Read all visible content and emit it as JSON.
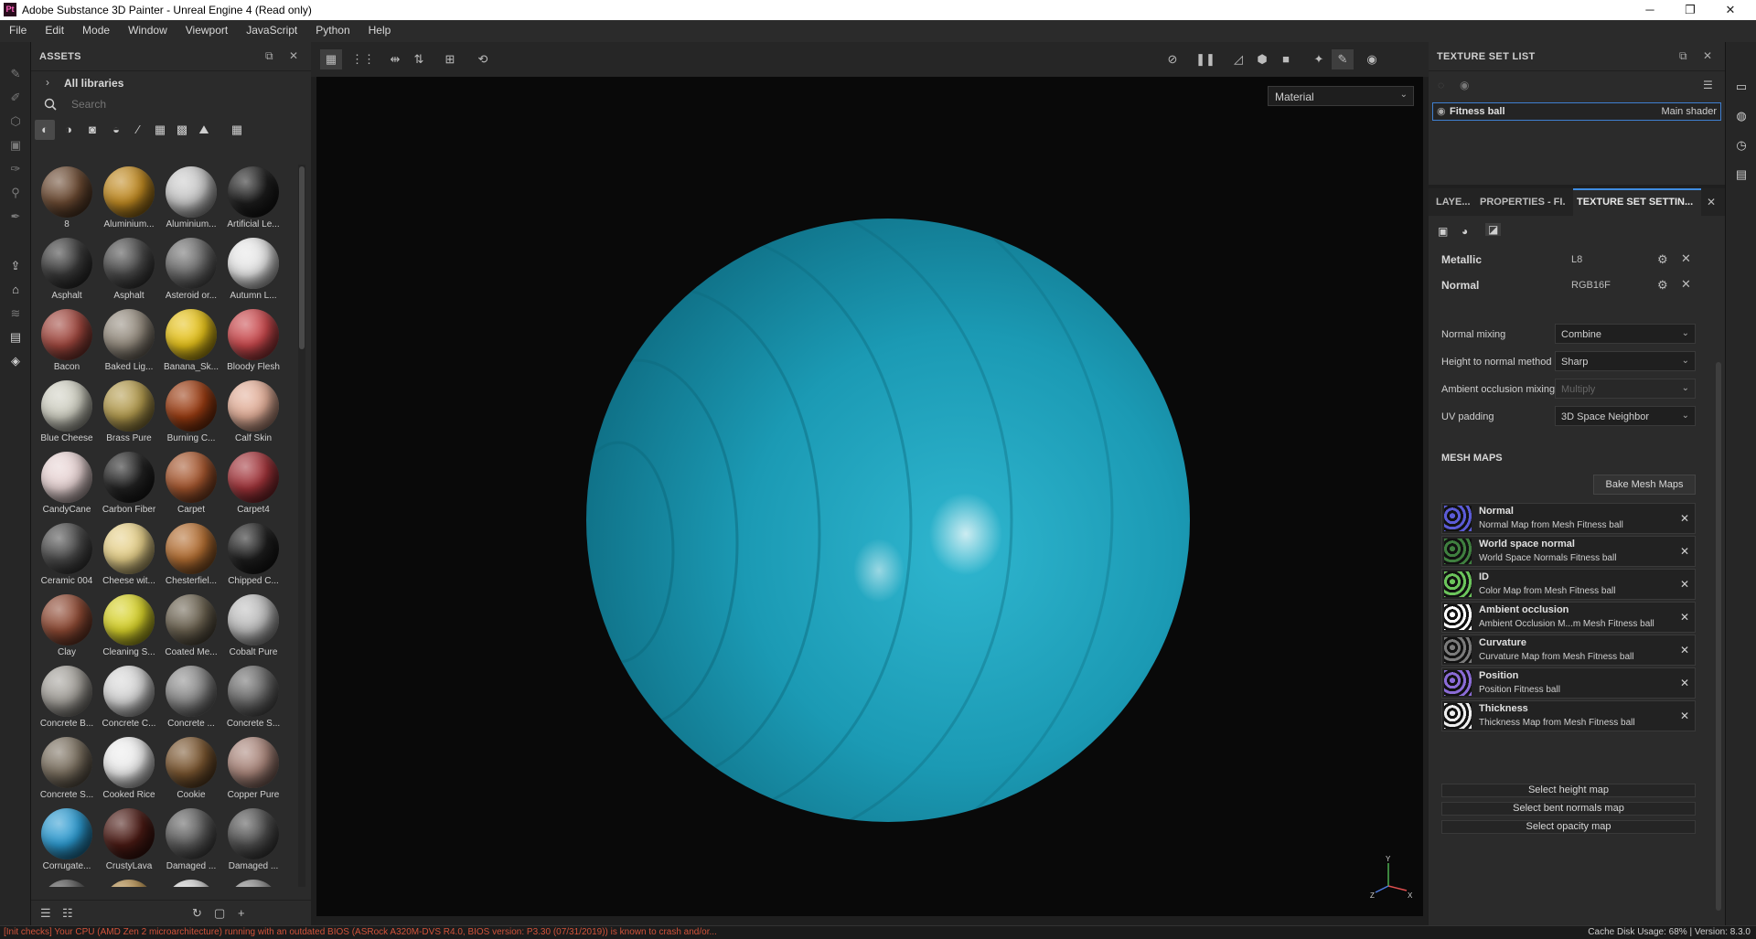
{
  "window": {
    "app_icon": "Pt",
    "title": "Adobe Substance 3D Painter - Unreal Engine 4 (Read only)",
    "minimize": "─",
    "maximize": "❐",
    "close": "✕"
  },
  "menu": [
    "File",
    "Edit",
    "Mode",
    "Window",
    "Viewport",
    "JavaScript",
    "Python",
    "Help"
  ],
  "assets": {
    "title": "ASSETS",
    "all_libraries": "All libraries",
    "search_placeholder": "Search",
    "items": [
      {
        "label": "8",
        "color": "#6b4a32"
      },
      {
        "label": "Aluminium...",
        "color": "#c08a22"
      },
      {
        "label": "Aluminium...",
        "color": "#c9c9c9"
      },
      {
        "label": "Artificial Le...",
        "color": "#1d1d1d"
      },
      {
        "label": "Asphalt",
        "color": "#3a3a3a"
      },
      {
        "label": "Asphalt",
        "color": "#4a4a4a"
      },
      {
        "label": "Asteroid or...",
        "color": "#6c6c6c"
      },
      {
        "label": "Autumn L...",
        "color": "#e6e6e6"
      },
      {
        "label": "Bacon",
        "color": "#a0473e"
      },
      {
        "label": "Baked Lig...",
        "color": "#948b7e"
      },
      {
        "label": "Banana_Sk...",
        "color": "#e6c21a"
      },
      {
        "label": "Bloody Flesh",
        "color": "#c9484c"
      },
      {
        "label": "Blue Cheese",
        "color": "#cfcfc2"
      },
      {
        "label": "Brass Pure",
        "color": "#b39b4e"
      },
      {
        "label": "Burning C...",
        "color": "#9a3c12"
      },
      {
        "label": "Calf Skin",
        "color": "#e2ae98"
      },
      {
        "label": "CandyCane",
        "color": "#e7d3d3"
      },
      {
        "label": "Carbon Fiber",
        "color": "#222222"
      },
      {
        "label": "Carpet",
        "color": "#a5562e"
      },
      {
        "label": "Carpet4",
        "color": "#a1343a"
      },
      {
        "label": "Ceramic 004",
        "color": "#4a4a4a"
      },
      {
        "label": "Cheese wit...",
        "color": "#e6d08a"
      },
      {
        "label": "Chesterfiel...",
        "color": "#b36e32"
      },
      {
        "label": "Chipped C...",
        "color": "#1e1e1e"
      },
      {
        "label": "Clay",
        "color": "#8e4a34"
      },
      {
        "label": "Cleaning S...",
        "color": "#d7d22a"
      },
      {
        "label": "Coated Me...",
        "color": "#6b6250"
      },
      {
        "label": "Cobalt Pure",
        "color": "#bdbdbd"
      },
      {
        "label": "Concrete B...",
        "color": "#a3a09a"
      },
      {
        "label": "Concrete C...",
        "color": "#d6d6d6"
      },
      {
        "label": "Concrete ...",
        "color": "#8a8a8a"
      },
      {
        "label": "Concrete S...",
        "color": "#6a6a6a"
      },
      {
        "label": "Concrete S...",
        "color": "#7b7060"
      },
      {
        "label": "Cooked Rice",
        "color": "#ececec"
      },
      {
        "label": "Cookie",
        "color": "#7a5630"
      },
      {
        "label": "Copper Pure",
        "color": "#a9857a"
      },
      {
        "label": "Corrugate...",
        "color": "#2c9ad0"
      },
      {
        "label": "CrustyLava",
        "color": "#4a1a14"
      },
      {
        "label": "Damaged ...",
        "color": "#5c5c5c"
      },
      {
        "label": "Damaged ...",
        "color": "#4f4f4f"
      },
      {
        "label": "",
        "color": "#555555"
      },
      {
        "label": "",
        "color": "#b08a4a"
      },
      {
        "label": "",
        "color": "#cfcfcf"
      },
      {
        "label": "",
        "color": "#8a8a8a"
      }
    ]
  },
  "viewport": {
    "mode_select": "Material",
    "axis_y": "Y",
    "axis_z": "Z",
    "axis_x": "X",
    "sphere_color": "#1ba2bd"
  },
  "texture_set_list": {
    "title": "TEXTURE SET LIST",
    "set_name": "Fitness ball",
    "shader": "Main shader"
  },
  "tabs": [
    "LAYE...",
    "PROPERTIES - FI...",
    "TEXTURE SET SETTIN..."
  ],
  "channels": [
    {
      "name": "Metallic",
      "format": "L8"
    },
    {
      "name": "Normal",
      "format": "RGB16F"
    }
  ],
  "settings": [
    {
      "label": "Normal mixing",
      "value": "Combine",
      "enabled": true
    },
    {
      "label": "Height to normal method",
      "value": "Sharp",
      "enabled": true
    },
    {
      "label": "Ambient occlusion mixing",
      "value": "Multiply",
      "enabled": false
    },
    {
      "label": "UV padding",
      "value": "3D Space Neighbor",
      "enabled": true
    }
  ],
  "mesh_maps": {
    "title": "MESH MAPS",
    "bake_button": "Bake Mesh Maps",
    "maps": [
      {
        "name": "Normal",
        "desc": "Normal Map from Mesh Fitness ball"
      },
      {
        "name": "World space normal",
        "desc": "World Space Normals Fitness ball"
      },
      {
        "name": "ID",
        "desc": "Color Map from Mesh Fitness ball"
      },
      {
        "name": "Ambient occlusion",
        "desc": "Ambient Occlusion M...m Mesh Fitness ball"
      },
      {
        "name": "Curvature",
        "desc": "Curvature Map from Mesh Fitness ball"
      },
      {
        "name": "Position",
        "desc": "Position Fitness ball"
      },
      {
        "name": "Thickness",
        "desc": "Thickness Map from Mesh Fitness ball"
      }
    ],
    "select_buttons": [
      "Select height map",
      "Select bent normals map",
      "Select opacity map"
    ]
  },
  "status": {
    "message": "[Init checks] Your CPU (AMD Zen 2 microarchitecture) running with an outdated BIOS (ASRock A320M-DVS R4.0, BIOS version: P3.30 (07/31/2019)) is known to crash and/or...",
    "right": "Cache Disk Usage:   68% | Version: 8.3.0"
  }
}
